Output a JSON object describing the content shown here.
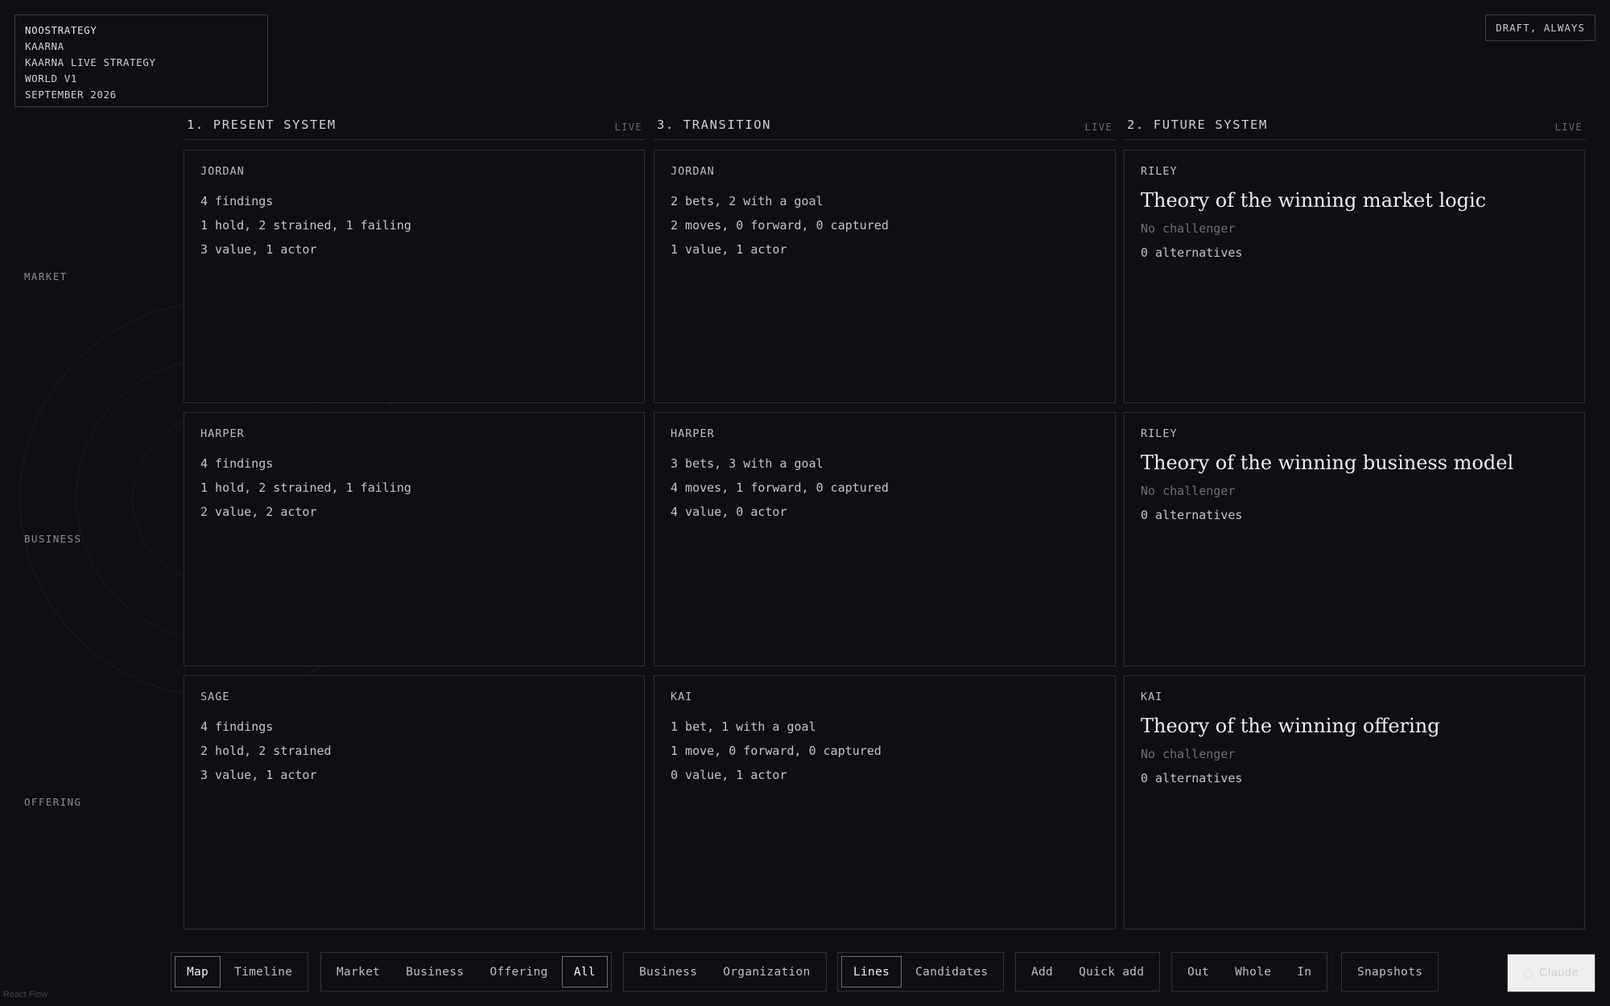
{
  "info": {
    "line1": "NOOSTRATEGY",
    "line2": "KAARNA",
    "line3": "KAARNA LIVE STRATEGY",
    "line4": "WORLD V1",
    "line5": "SEPTEMBER 2026"
  },
  "draft_badge": "DRAFT, ALWAYS",
  "columns": [
    {
      "title": "1. PRESENT SYSTEM",
      "status": "LIVE"
    },
    {
      "title": "3. TRANSITION",
      "status": "LIVE"
    },
    {
      "title": "2. FUTURE SYSTEM",
      "status": "LIVE"
    }
  ],
  "rows": [
    {
      "label": "MARKET"
    },
    {
      "label": "BUSINESS"
    },
    {
      "label": "OFFERING"
    }
  ],
  "cards": {
    "present_market": {
      "owner": "JORDAN",
      "l1": "4 findings",
      "l2": "1 hold, 2 strained, 1 failing",
      "l3": "3 value, 1 actor"
    },
    "present_business": {
      "owner": "HARPER",
      "l1": "4 findings",
      "l2": "1 hold, 2 strained, 1 failing",
      "l3": "2 value, 2 actor"
    },
    "present_offering": {
      "owner": "SAGE",
      "l1": "4 findings",
      "l2": "2 hold, 2 strained",
      "l3": "3 value, 1 actor"
    },
    "transition_market": {
      "owner": "JORDAN",
      "l1": "2 bets, 2 with a goal",
      "l2": "2 moves, 0 forward, 0 captured",
      "l3": "1 value, 1 actor"
    },
    "transition_business": {
      "owner": "HARPER",
      "l1": "3 bets, 3 with a goal",
      "l2": "4 moves, 1 forward, 0 captured",
      "l3": "4 value, 0 actor"
    },
    "transition_offering": {
      "owner": "KAI",
      "l1": "1 bet, 1 with a goal",
      "l2": "1 move, 0 forward, 0 captured",
      "l3": "0 value, 1 actor"
    },
    "future_market": {
      "owner": "RILEY",
      "theory": "Theory of the winning market logic",
      "challenger": "No challenger",
      "alternatives": "0 alternatives"
    },
    "future_business": {
      "owner": "RILEY",
      "theory": "Theory of the winning business model",
      "challenger": "No challenger",
      "alternatives": "0 alternatives"
    },
    "future_offering": {
      "owner": "KAI",
      "theory": "Theory of the winning offering",
      "challenger": "No challenger",
      "alternatives": "0 alternatives"
    }
  },
  "toolbar": {
    "view": {
      "map": "Map",
      "timeline": "Timeline",
      "active": "Map"
    },
    "layer": {
      "market": "Market",
      "business": "Business",
      "offering": "Offering",
      "all": "All",
      "active": "All"
    },
    "scope": {
      "business": "Business",
      "organization": "Organization"
    },
    "display": {
      "lines": "Lines",
      "candidates": "Candidates",
      "active": "Lines"
    },
    "add": {
      "add": "Add",
      "quick_add": "Quick add"
    },
    "zoom": {
      "out": "Out",
      "whole": "Whole",
      "in": "In"
    },
    "snapshots": "Snapshots",
    "claude": "Claude"
  },
  "attribution": "React Flow",
  "colors": {
    "background": "#0e0e13",
    "border": "#2d2d34",
    "text": "#c9c9cf",
    "muted": "#6c6c74"
  }
}
